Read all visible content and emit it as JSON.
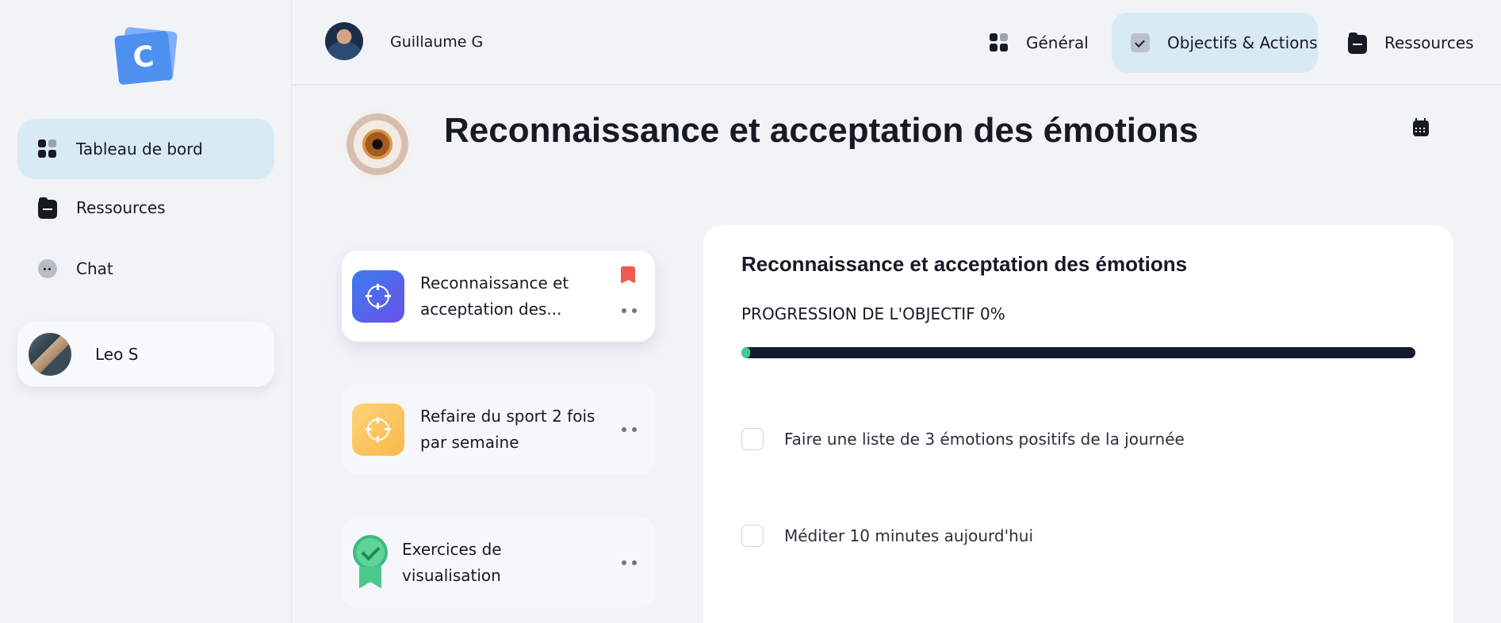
{
  "sidebar": {
    "logo_letter": "C",
    "items": [
      {
        "label": "Tableau de bord",
        "icon": "grid-icon",
        "active": true
      },
      {
        "label": "Ressources",
        "icon": "folder-icon",
        "active": false
      },
      {
        "label": "Chat",
        "icon": "chat-icon",
        "active": false
      }
    ],
    "user": {
      "name": "Leo S"
    }
  },
  "topbar": {
    "user_name": "Guillaume G",
    "tabs": [
      {
        "label": "Général",
        "icon": "grid-icon",
        "active": false
      },
      {
        "label": "Objectifs & Actions",
        "icon": "checkbox-icon",
        "active": true
      },
      {
        "label": "Ressources",
        "icon": "folder-icon",
        "active": false
      }
    ]
  },
  "page": {
    "title": "Reconnaissance et acceptation des émotions",
    "header_icon": "calendar-icon"
  },
  "goals": [
    {
      "label": "Reconnaissance et acceptation des...",
      "icon": "target-icon",
      "icon_color": "#4f6cf0",
      "flagged": true,
      "selected": true
    },
    {
      "label": "Refaire du sport 2 fois par semaine",
      "icon": "target-icon",
      "icon_color": "#fbc35c",
      "flagged": false,
      "selected": false
    },
    {
      "label": "Exercices de visualisation",
      "icon": "badge-icon",
      "icon_color": "#4cc98c",
      "flagged": false,
      "selected": false
    }
  ],
  "detail": {
    "title": "Reconnaissance et acceptation des émotions",
    "progress_label": "PROGRESSION DE L'OBJECTIF 0%",
    "progress_value": 0,
    "tasks": [
      {
        "label": "Faire une liste de 3 émotions positifs de la journée",
        "checked": false
      },
      {
        "label": "Méditer 10 minutes aujourd'hui",
        "checked": false
      }
    ]
  },
  "colors": {
    "accent_active_bg": "#d8eaf4",
    "progress_track": "#111b2c",
    "progress_fill": "#3ccf8e",
    "flag": "#ec5b52"
  }
}
